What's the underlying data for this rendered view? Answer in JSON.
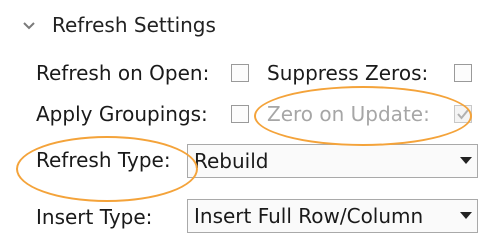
{
  "section": {
    "title": "Refresh Settings"
  },
  "fields": {
    "refresh_on_open": {
      "label": "Refresh on Open:",
      "checked": false
    },
    "suppress_zeros": {
      "label": "Suppress Zeros:",
      "checked": false
    },
    "apply_groupings": {
      "label": "Apply Groupings:",
      "checked": false
    },
    "zero_on_update": {
      "label": "Zero on Update:",
      "checked": true,
      "disabled": true
    },
    "refresh_type": {
      "label": "Refresh Type:",
      "value": "Rebuild"
    },
    "insert_type": {
      "label": "Insert Type:",
      "value": "Insert Full Row/Column"
    }
  },
  "colors": {
    "highlight": "#f4a33a"
  }
}
